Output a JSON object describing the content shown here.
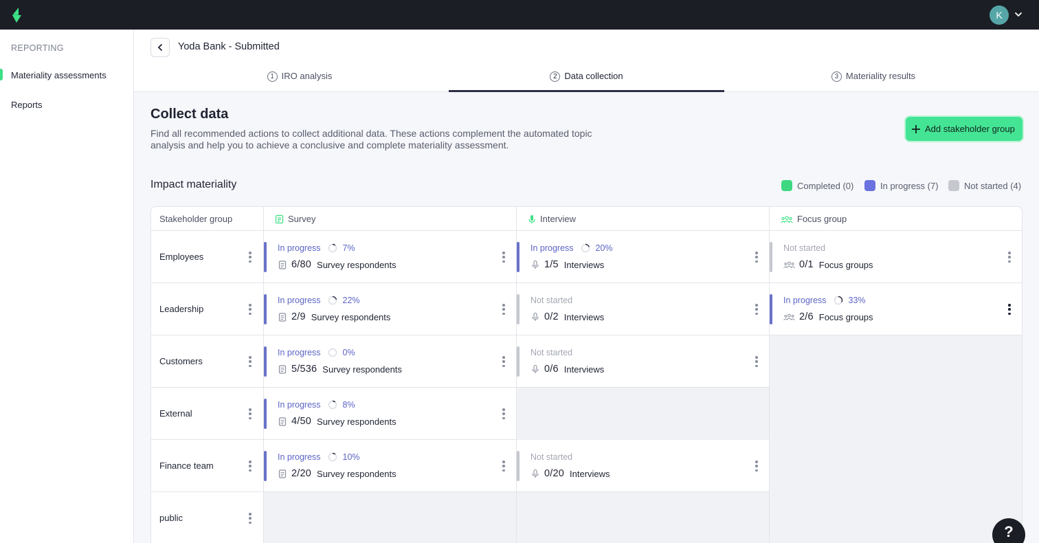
{
  "user": {
    "initial": "K"
  },
  "sidebar": {
    "heading": "REPORTING",
    "items": [
      {
        "label": "Materiality assessments",
        "active": true
      },
      {
        "label": "Reports",
        "active": false
      }
    ]
  },
  "header": {
    "title": "Yoda Bank - Submitted",
    "tabs": [
      {
        "num": "1",
        "label": "IRO analysis",
        "active": false
      },
      {
        "num": "2",
        "label": "Data collection",
        "active": true
      },
      {
        "num": "3",
        "label": "Materiality results",
        "active": false
      }
    ]
  },
  "page": {
    "title": "Collect data",
    "description": "Find all recommended actions to collect additional data. These actions complement the automated topic analysis and help you to achieve a conclusive and complete materiality assessment.",
    "add_button": "Add stakeholder group"
  },
  "section": {
    "title": "Impact materiality",
    "legend": [
      {
        "label": "Completed (0)",
        "color": "#3ed882"
      },
      {
        "label": "In progress (7)",
        "color": "#6a72e0"
      },
      {
        "label": "Not started (4)",
        "color": "#c6c8cf"
      }
    ]
  },
  "table": {
    "columns": [
      "Stakeholder group",
      "Survey",
      "Interview",
      "Focus group"
    ],
    "rows": [
      {
        "group": "Employees",
        "survey": {
          "status": "In progress",
          "state": "prog",
          "pct": "7%",
          "progress": 0.07,
          "count": "6/80",
          "unit": "Survey respondents"
        },
        "interview": {
          "status": "In progress",
          "state": "prog",
          "pct": "20%",
          "progress": 0.2,
          "count": "1/5",
          "unit": "Interviews"
        },
        "focus": {
          "status": "Not started",
          "state": "none",
          "pct": "",
          "count": "0/1",
          "unit": "Focus groups"
        }
      },
      {
        "group": "Leadership",
        "survey": {
          "status": "In progress",
          "state": "prog",
          "pct": "22%",
          "progress": 0.22,
          "count": "2/9",
          "unit": "Survey respondents"
        },
        "interview": {
          "status": "Not started",
          "state": "none",
          "pct": "",
          "count": "0/2",
          "unit": "Interviews"
        },
        "focus": {
          "status": "In progress",
          "state": "prog",
          "pct": "33%",
          "progress": 0.33,
          "count": "2/6",
          "unit": "Focus groups"
        }
      },
      {
        "group": "Customers",
        "survey": {
          "status": "In progress",
          "state": "prog",
          "pct": "0%",
          "progress": 0,
          "count": "5/536",
          "unit": "Survey respondents"
        },
        "interview": {
          "status": "Not started",
          "state": "none",
          "pct": "",
          "count": "0/6",
          "unit": "Interviews"
        },
        "focus": null
      },
      {
        "group": "External",
        "survey": {
          "status": "In progress",
          "state": "prog",
          "pct": "8%",
          "progress": 0.08,
          "count": "4/50",
          "unit": "Survey respondents"
        },
        "interview": null,
        "focus": null
      },
      {
        "group": "Finance team",
        "survey": {
          "status": "In progress",
          "state": "prog",
          "pct": "10%",
          "progress": 0.1,
          "count": "2/20",
          "unit": "Survey respondents"
        },
        "interview": {
          "status": "Not started",
          "state": "none",
          "pct": "",
          "count": "0/20",
          "unit": "Interviews"
        },
        "focus": null
      },
      {
        "group": "public",
        "survey": null,
        "interview": null,
        "focus": null
      }
    ]
  },
  "help": {
    "label": "?"
  }
}
